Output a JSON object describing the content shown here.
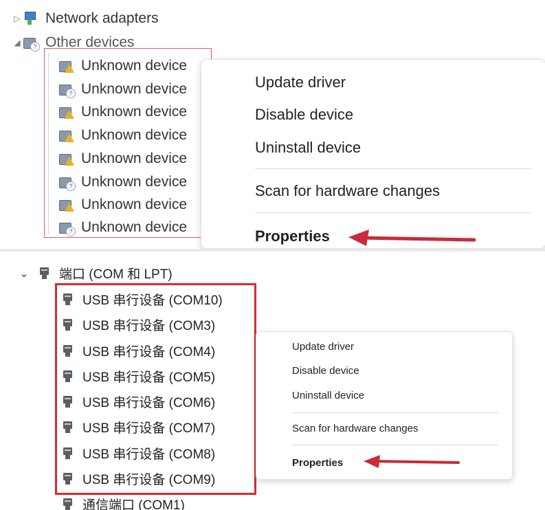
{
  "top": {
    "tree": {
      "network_adapters": "Network adapters",
      "other_devices": "Other devices",
      "unknown_devices": [
        "Unknown device",
        "Unknown device",
        "Unknown device",
        "Unknown device",
        "Unknown device",
        "Unknown device",
        "Unknown device",
        "Unknown device"
      ]
    },
    "context_menu": {
      "update_driver": "Update driver",
      "disable_device": "Disable device",
      "uninstall_device": "Uninstall device",
      "scan_hardware": "Scan for hardware changes",
      "properties": "Properties"
    }
  },
  "bottom": {
    "tree": {
      "ports_group": "端口 (COM 和 LPT)",
      "usb_ports": [
        "USB 串行设备 (COM10)",
        "USB 串行设备 (COM3)",
        "USB 串行设备 (COM4)",
        "USB 串行设备 (COM5)",
        "USB 串行设备 (COM6)",
        "USB 串行设备 (COM7)",
        "USB 串行设备 (COM8)",
        "USB 串行设备 (COM9)"
      ],
      "comm_port": "通信端口 (COM1)"
    },
    "context_menu": {
      "update_driver": "Update driver",
      "disable_device": "Disable device",
      "uninstall_device": "Uninstall device",
      "scan_hardware": "Scan for hardware changes",
      "properties": "Properties"
    }
  },
  "colors": {
    "highlight_box": "#e23b3b",
    "arrow": "#c92b3a"
  }
}
